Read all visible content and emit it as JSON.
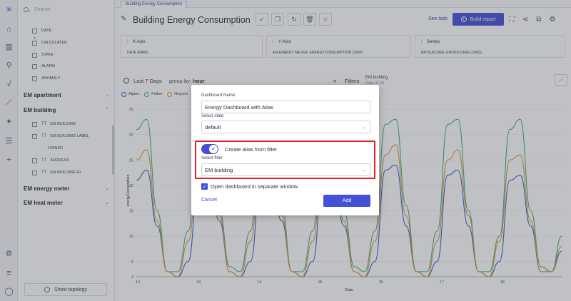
{
  "sidebar": {
    "search_placeholder": "Search",
    "fields_top": [
      {
        "label": "DATE",
        "icon": "calendar-icon"
      },
      {
        "label": "CALCULATED",
        "icon": "calculator-icon"
      },
      {
        "label": "STATE",
        "icon": "list-icon"
      },
      {
        "label": "ALARM",
        "icon": "alarm-icon"
      },
      {
        "label": "ANOMALY",
        "icon": "anomaly-icon"
      }
    ],
    "groups": [
      {
        "label": "EM apartment"
      },
      {
        "label": "EM building"
      },
      {
        "label": "EM energy meter"
      },
      {
        "label": "EM heat meter"
      }
    ],
    "building_fields": [
      {
        "prefix": "Tт",
        "label": "EM BUILDING"
      },
      {
        "prefix": "Tт",
        "label": "EM BUILDING LABEL"
      },
      {
        "prefix": "",
        "label": "OWNER"
      },
      {
        "prefix": "Tт",
        "label": "ADDRESS"
      },
      {
        "prefix": "Tт",
        "label": "EM BUILDING ID"
      }
    ],
    "show_topology": "Show topology"
  },
  "tab": {
    "label": "Building Energy Consumption"
  },
  "header": {
    "title": "Building Energy Consumption",
    "see_task": "See task",
    "build_report": "Build report"
  },
  "axes": {
    "x": {
      "label": "X Axis",
      "value": "DATE (RAW)"
    },
    "y": {
      "label": "Y Axis",
      "value": "EM ENERGY METER: ENERGYCONSUMPTION (SUM)"
    },
    "series": {
      "label": "Series",
      "value": "EM BUILDING: EM BUILDING (UNIQ)"
    }
  },
  "controls": {
    "range": "Last 7 Days",
    "group_by_label": "group by:",
    "group_by_value": "hour",
    "filters_label": "Filters",
    "filter_name": "EM building",
    "filter_sub": "One of   All"
  },
  "chart_data": {
    "type": "line",
    "xlabel": "Date",
    "ylabel": "energyConsumption",
    "ylim": [
      2,
      36
    ],
    "yticks": [
      2,
      5,
      10,
      15,
      20,
      25,
      30,
      35
    ],
    "xticks": [
      "12",
      "13",
      "14",
      "15",
      "16",
      "17",
      "18"
    ],
    "series": [
      {
        "name": "Alpine",
        "color": "#2f63d3",
        "values": [
          21,
          23,
          12,
          3,
          2,
          5,
          21,
          23,
          13,
          3,
          2,
          5,
          21,
          22,
          13,
          3,
          2,
          5,
          22,
          23,
          12,
          3,
          2,
          5,
          23,
          24,
          12,
          3,
          2,
          5,
          22,
          23,
          12,
          3,
          2,
          5,
          21,
          22,
          12,
          3,
          3,
          7
        ]
      },
      {
        "name": "Feline",
        "color": "#3fb27f",
        "values": [
          31,
          33,
          15,
          3,
          3,
          11,
          32,
          33,
          15,
          4,
          3,
          11,
          31,
          33,
          16,
          3,
          3,
          11,
          32,
          34,
          15,
          4,
          3,
          11,
          32,
          33,
          16,
          3,
          3,
          11,
          32,
          33,
          15,
          3,
          3,
          10,
          31,
          33,
          15,
          4,
          3,
          10
        ]
      },
      {
        "name": "Heguini",
        "color": "#e49a2e",
        "values": [
          25,
          27,
          13,
          3,
          2,
          9,
          25,
          26,
          14,
          3,
          2,
          9,
          25,
          27,
          14,
          3,
          2,
          9,
          26,
          27,
          13,
          3,
          2,
          9,
          26,
          28,
          14,
          3,
          2,
          9,
          25,
          27,
          14,
          3,
          2,
          9,
          25,
          26,
          13,
          3,
          3,
          8
        ]
      }
    ]
  },
  "modal": {
    "name_label": "Dashboard Name",
    "name_value": "Energy Dashboard with Alias",
    "state_label": "Select state",
    "state_value": "default",
    "alias_label": "Create alias from filter",
    "filter_label": "Select filter",
    "filter_value": "EM building",
    "separate_window_label": "Open dashboard in separate window",
    "cancel": "Cancel",
    "add": "Add"
  }
}
